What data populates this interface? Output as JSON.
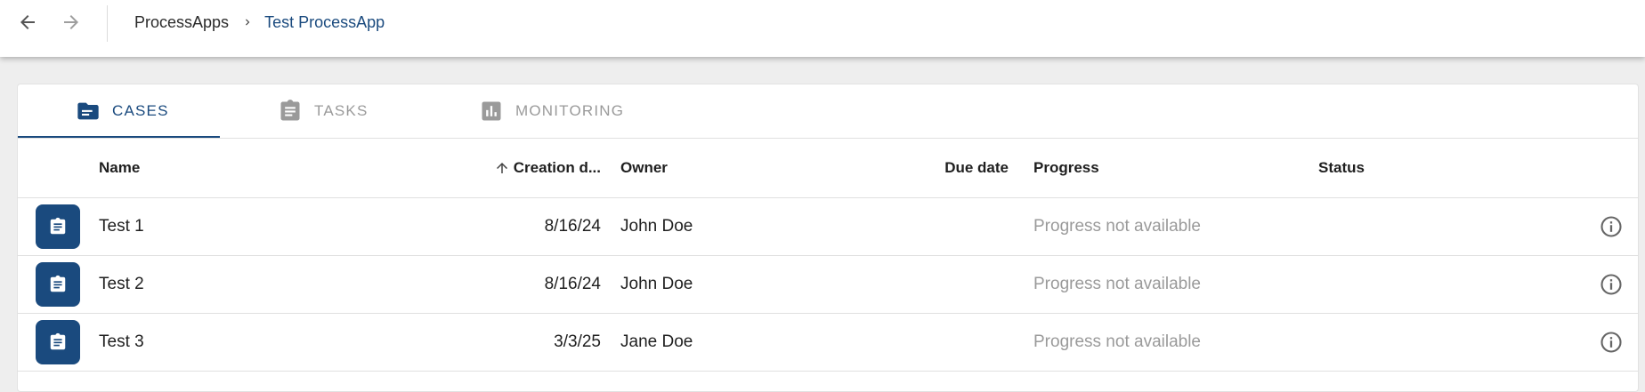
{
  "breadcrumb": {
    "root": "ProcessApps",
    "current": "Test ProcessApp"
  },
  "tabs": [
    {
      "label": "CASES",
      "icon": "folder-icon",
      "active": true
    },
    {
      "label": "TASKS",
      "icon": "clipboard-icon",
      "active": false
    },
    {
      "label": "MONITORING",
      "icon": "bar-chart-icon",
      "active": false
    }
  ],
  "table": {
    "columns": {
      "name": "Name",
      "creation_date": "Creation d...",
      "owner": "Owner",
      "due_date": "Due date",
      "progress": "Progress",
      "status": "Status"
    },
    "sort": {
      "column": "creation_date",
      "direction": "ascending"
    },
    "rows": [
      {
        "name": "Test 1",
        "creation_date": "8/16/24",
        "owner": "John Doe",
        "due_date": "",
        "progress": "Progress not available",
        "status": ""
      },
      {
        "name": "Test 2",
        "creation_date": "8/16/24",
        "owner": "John Doe",
        "due_date": "",
        "progress": "Progress not available",
        "status": ""
      },
      {
        "name": "Test 3",
        "creation_date": "3/3/25",
        "owner": "Jane Doe",
        "due_date": "",
        "progress": "Progress not available",
        "status": ""
      }
    ]
  },
  "colors": {
    "accent": "#1a4a7e",
    "muted_text": "#9a9a9a",
    "page_background": "#eeeeee"
  }
}
